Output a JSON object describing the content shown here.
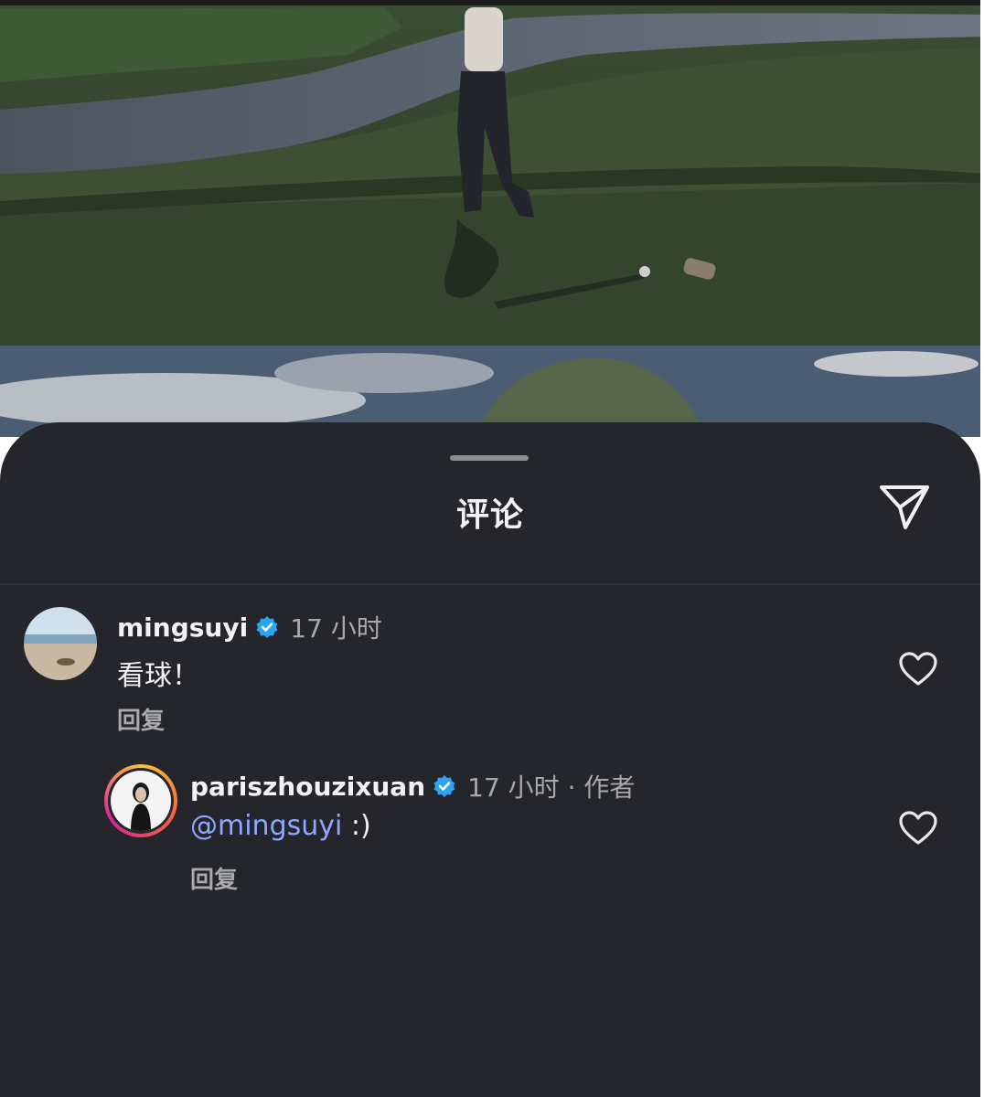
{
  "sheet": {
    "title": "评论"
  },
  "icons": {
    "share": "paper-plane-icon",
    "like": "heart-outline-icon",
    "verified": "verified-badge-icon"
  },
  "colors": {
    "sheet_background": "#25262b",
    "verified_blue": "#2aa4f4",
    "mention_blue": "#8fa8ff",
    "secondary_text": "#a8a9ad"
  },
  "comments": [
    {
      "username": "mingsuyi",
      "meta": "17 小时",
      "text": "看球！",
      "reply_label": "回复"
    },
    {
      "username": "pariszhouzixuan",
      "meta": "17 小时 · 作者",
      "mention": "@mingsuyi",
      "text_after_mention": " :)",
      "reply_label": "回复"
    }
  ]
}
